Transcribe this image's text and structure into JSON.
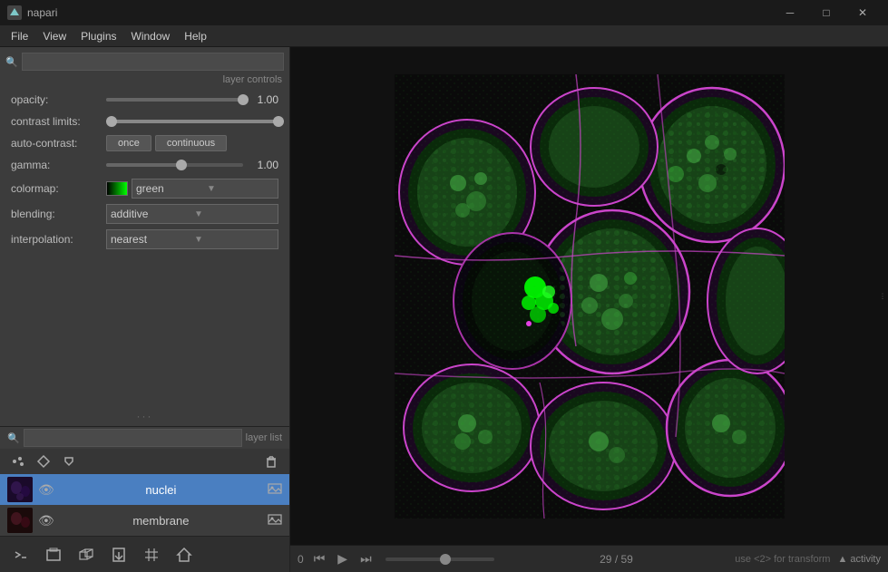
{
  "titleBar": {
    "appName": "napari",
    "minBtn": "─",
    "maxBtn": "□",
    "closeBtn": "✕"
  },
  "menuBar": {
    "items": [
      "File",
      "View",
      "Plugins",
      "Window",
      "Help"
    ]
  },
  "layerControls": {
    "header": "layer controls",
    "opacity": {
      "label": "opacity:",
      "value": "1.00",
      "fillPct": 100
    },
    "contrastLimits": {
      "label": "contrast limits:"
    },
    "autoContrast": {
      "label": "auto-contrast:",
      "onceBtn": "once",
      "continuousBtn": "continuous"
    },
    "gamma": {
      "label": "gamma:",
      "value": "1.00",
      "fillPct": 55
    },
    "colormap": {
      "label": "colormap:",
      "value": "green"
    },
    "blending": {
      "label": "blending:",
      "value": "additive"
    },
    "interpolation": {
      "label": "interpolation:",
      "value": "nearest"
    }
  },
  "layerList": {
    "header": "layer list",
    "layers": [
      {
        "name": "nuclei",
        "visible": true,
        "active": true,
        "thumbType": "nuclei"
      },
      {
        "name": "membrane",
        "visible": true,
        "active": false,
        "thumbType": "membrane"
      }
    ]
  },
  "bottomToolbar": {
    "tools": [
      "⌨",
      "□",
      "⊞",
      "⬆",
      "⬇",
      "⌂"
    ]
  },
  "statusBar": {
    "frameLabel": "0",
    "frameStart": "29",
    "frameEnd": "59",
    "hint": "use <2> for transform",
    "activity": "activity"
  }
}
